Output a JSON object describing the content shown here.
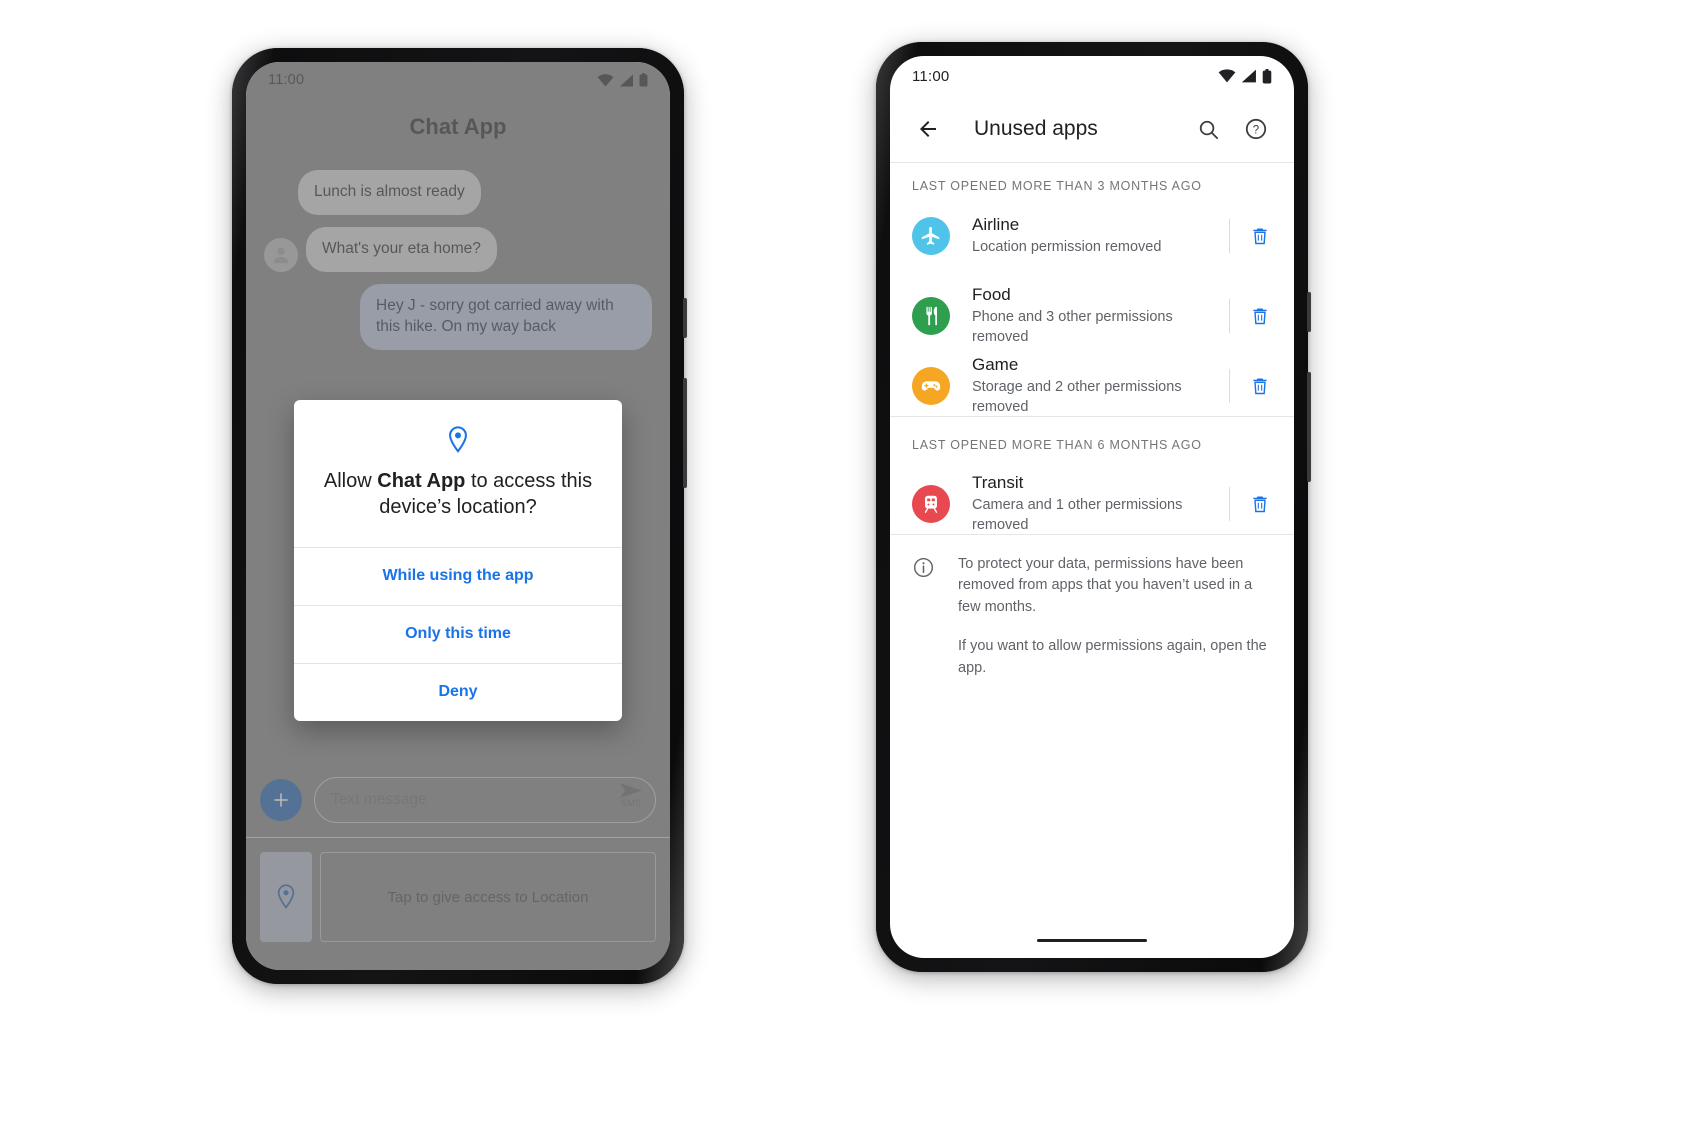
{
  "left_phone": {
    "status_bar": {
      "time": "11:00",
      "icons": [
        "wifi-icon",
        "cellular-signal-icon",
        "battery-icon"
      ]
    },
    "chat": {
      "title": "Chat App",
      "messages": [
        {
          "text": "Lunch is almost ready",
          "side": "in",
          "avatar": false
        },
        {
          "text": "What's your eta home?",
          "side": "in",
          "avatar": true
        },
        {
          "text": "Hey J - sorry got carried away with this hike. On my way back",
          "side": "out",
          "avatar": false
        }
      ],
      "composer": {
        "plus_label": "+",
        "placeholder": "Text message",
        "send_label": "SMS"
      },
      "location_suggestion": {
        "label": "Tap to give access to Location",
        "chip_icon": "location-pin-icon"
      }
    },
    "permission_dialog": {
      "icon": "location-pin-icon",
      "question_prefix": "Allow ",
      "question_app": "Chat App",
      "question_suffix": " to access this device’s location?",
      "options": [
        "While using the app",
        "Only this time",
        "Deny"
      ]
    }
  },
  "right_phone": {
    "status_bar": {
      "time": "11:00",
      "icons": [
        "wifi-icon",
        "cellular-signal-icon",
        "battery-icon"
      ]
    },
    "app_bar": {
      "back_icon": "back-arrow-icon",
      "title": "Unused apps",
      "search_icon": "search-icon",
      "help_icon": "help-circle-icon"
    },
    "sections": [
      {
        "header": "LAST OPENED MORE THAN 3 MONTHS AGO",
        "apps": [
          {
            "name": "Airline",
            "subtitle": "Location permission removed",
            "icon": "airplane-icon",
            "color": "#4fc3e8",
            "delete_icon": "trash-icon"
          },
          {
            "name": "Food",
            "subtitle": "Phone and 3 other permissions removed",
            "icon": "restaurant-icon",
            "color": "#2e9e4f",
            "delete_icon": "trash-icon"
          },
          {
            "name": "Game",
            "subtitle": "Storage and 2 other permissions removed",
            "icon": "gamepad-icon",
            "color": "#f5a623",
            "delete_icon": "trash-icon"
          }
        ]
      },
      {
        "header": "LAST OPENED MORE THAN 6 MONTHS AGO",
        "apps": [
          {
            "name": "Transit",
            "subtitle": "Camera and 1 other permissions removed",
            "icon": "train-icon",
            "color": "#e8484f",
            "delete_icon": "trash-icon"
          }
        ]
      }
    ],
    "footer_info": {
      "icon": "info-circle-icon",
      "paragraphs": [
        "To protect your data, permissions have been removed from  apps that you haven’t used in a few months.",
        "If you want to allow permissions again, open the app."
      ]
    }
  },
  "colors": {
    "accent_blue": "#1a73e8",
    "link_blue": "#1a73e8",
    "fab_blue": "#1a5fb4",
    "text_primary": "#202124",
    "text_secondary": "#5f6368"
  }
}
